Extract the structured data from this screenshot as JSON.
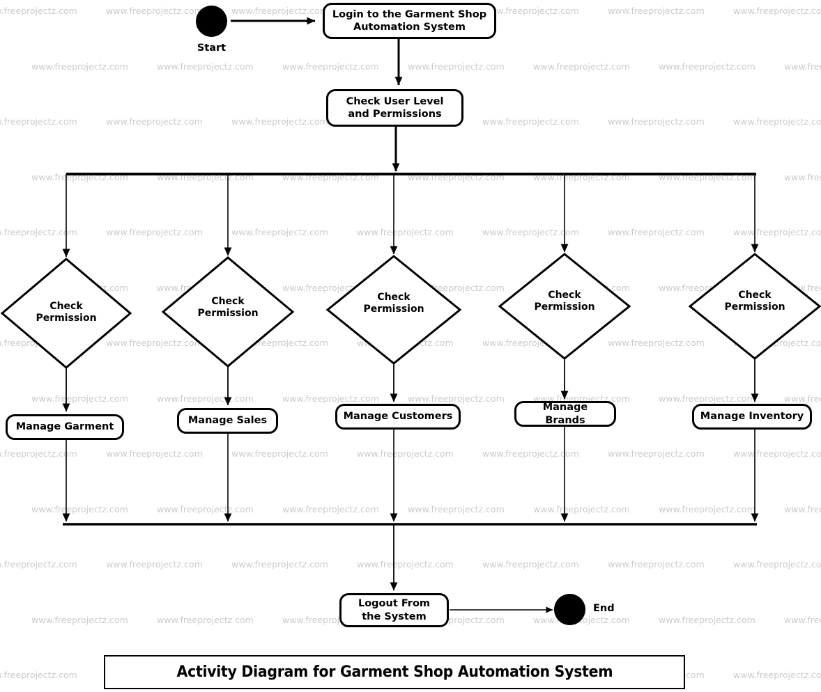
{
  "diagram": {
    "kind": "uml-activity-diagram",
    "title": "Activity Diagram for Garment Shop Automation System",
    "watermark_text": "www.freeprojectz.com",
    "colors": {
      "stroke": "#000000",
      "fill": "#ffffff",
      "watermark": "#c9c9c9"
    }
  },
  "nodes": {
    "start": {
      "type": "initial-node",
      "label": "Start"
    },
    "login": {
      "type": "activity",
      "label": "Login to the Garment  Shop Automation System"
    },
    "check_user": {
      "type": "activity",
      "label": "Check User Level and Permissions"
    },
    "logout": {
      "type": "activity",
      "label": "Logout From the System"
    },
    "end": {
      "type": "final-node",
      "label": "End"
    }
  },
  "branches": [
    {
      "id": "garment",
      "decision_label": "Check\nPermission",
      "activity_label": "Manage Garment"
    },
    {
      "id": "sales",
      "decision_label": "Check\nPermission",
      "activity_label": "Manage Sales"
    },
    {
      "id": "customers",
      "decision_label": "Check\nPermission",
      "activity_label": "Manage Customers"
    },
    {
      "id": "brands",
      "decision_label": "Check\nPermission",
      "activity_label": "Manage Brands"
    },
    {
      "id": "inventory",
      "decision_label": "Check\nPermission",
      "activity_label": "Manage Inventory"
    }
  ]
}
